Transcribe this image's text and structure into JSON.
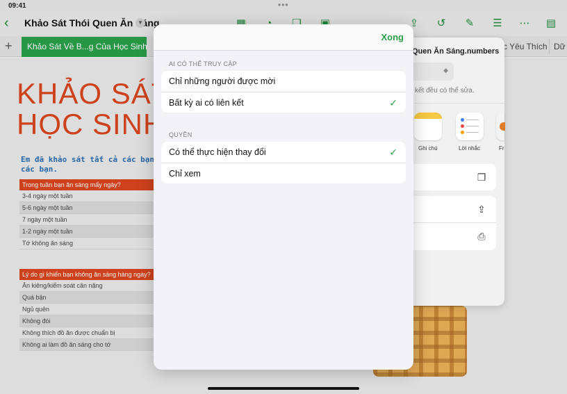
{
  "status_bar": {
    "time": "09:41"
  },
  "toolbar": {
    "back_icon": "chevron-left-icon",
    "doc_title": "Khảo Sát Thói Quen Ăn Sáng",
    "icons": [
      "table-icon",
      "chart-icon",
      "shape-icon",
      "media-icon",
      "share-icon",
      "undo-icon",
      "format-brush-icon",
      "filter-icon",
      "more-icon",
      "document-icon"
    ]
  },
  "tabs": {
    "active": "Khảo Sát Về B...g Của Học Sinh",
    "other1": "c Yêu Thích",
    "other2": "Dữ"
  },
  "sheet": {
    "title_line1": "KHẢO SÁT",
    "title_line2": "HỌC SINH",
    "subtitle_line1": "Em đã khảo sát tất cả các bạn",
    "subtitle_line2": "các bạn.",
    "table1": {
      "header": "Trong tuần bạn ăn sáng mấy ngày?",
      "rows": [
        "3-4 ngày một tuần",
        "5-6 ngày một tuần",
        "7 ngày một tuần",
        "1-2 ngày một tuần",
        "Tớ không ăn sáng"
      ]
    },
    "table2": {
      "header": "Lý do gì khiến bạn không ăn sáng hàng ngày?",
      "rows": [
        "Ăn kiêng/kiểm soát cân nặng",
        "Quá bận",
        "Ngủ quên",
        "Không đói",
        "Không thích đồ ăn được chuẩn bị",
        "Không ai làm đồ ăn sáng cho tớ"
      ]
    }
  },
  "share_panel": {
    "file_name": "Quen Ăn Sáng.numbers",
    "access_desc": "kết đều có thể sửa.",
    "apps": [
      {
        "name": "Ghi chú",
        "icon": "notes-app-icon"
      },
      {
        "name": "Lời nhắc",
        "icon": "reminders-app-icon"
      },
      {
        "name": "Fr",
        "icon": "freeform-app-icon"
      }
    ],
    "actions": [
      "copy-icon",
      "share-icon",
      "print-icon"
    ]
  },
  "modal": {
    "done_label": "Xong",
    "access_section": {
      "label": "AI CÓ THỂ TRUY CẬP",
      "options": [
        {
          "label": "Chỉ những người được mời",
          "selected": false
        },
        {
          "label": "Bất kỳ ai có liên kết",
          "selected": true
        }
      ]
    },
    "permission_section": {
      "label": "QUYỀN",
      "options": [
        {
          "label": "Có thể thực hiện thay đổi",
          "selected": true
        },
        {
          "label": "Chỉ xem",
          "selected": false
        }
      ]
    }
  },
  "colors": {
    "accent": "#2aa04a",
    "title_red": "#d8451e",
    "subtitle_blue": "#2a6db0"
  }
}
